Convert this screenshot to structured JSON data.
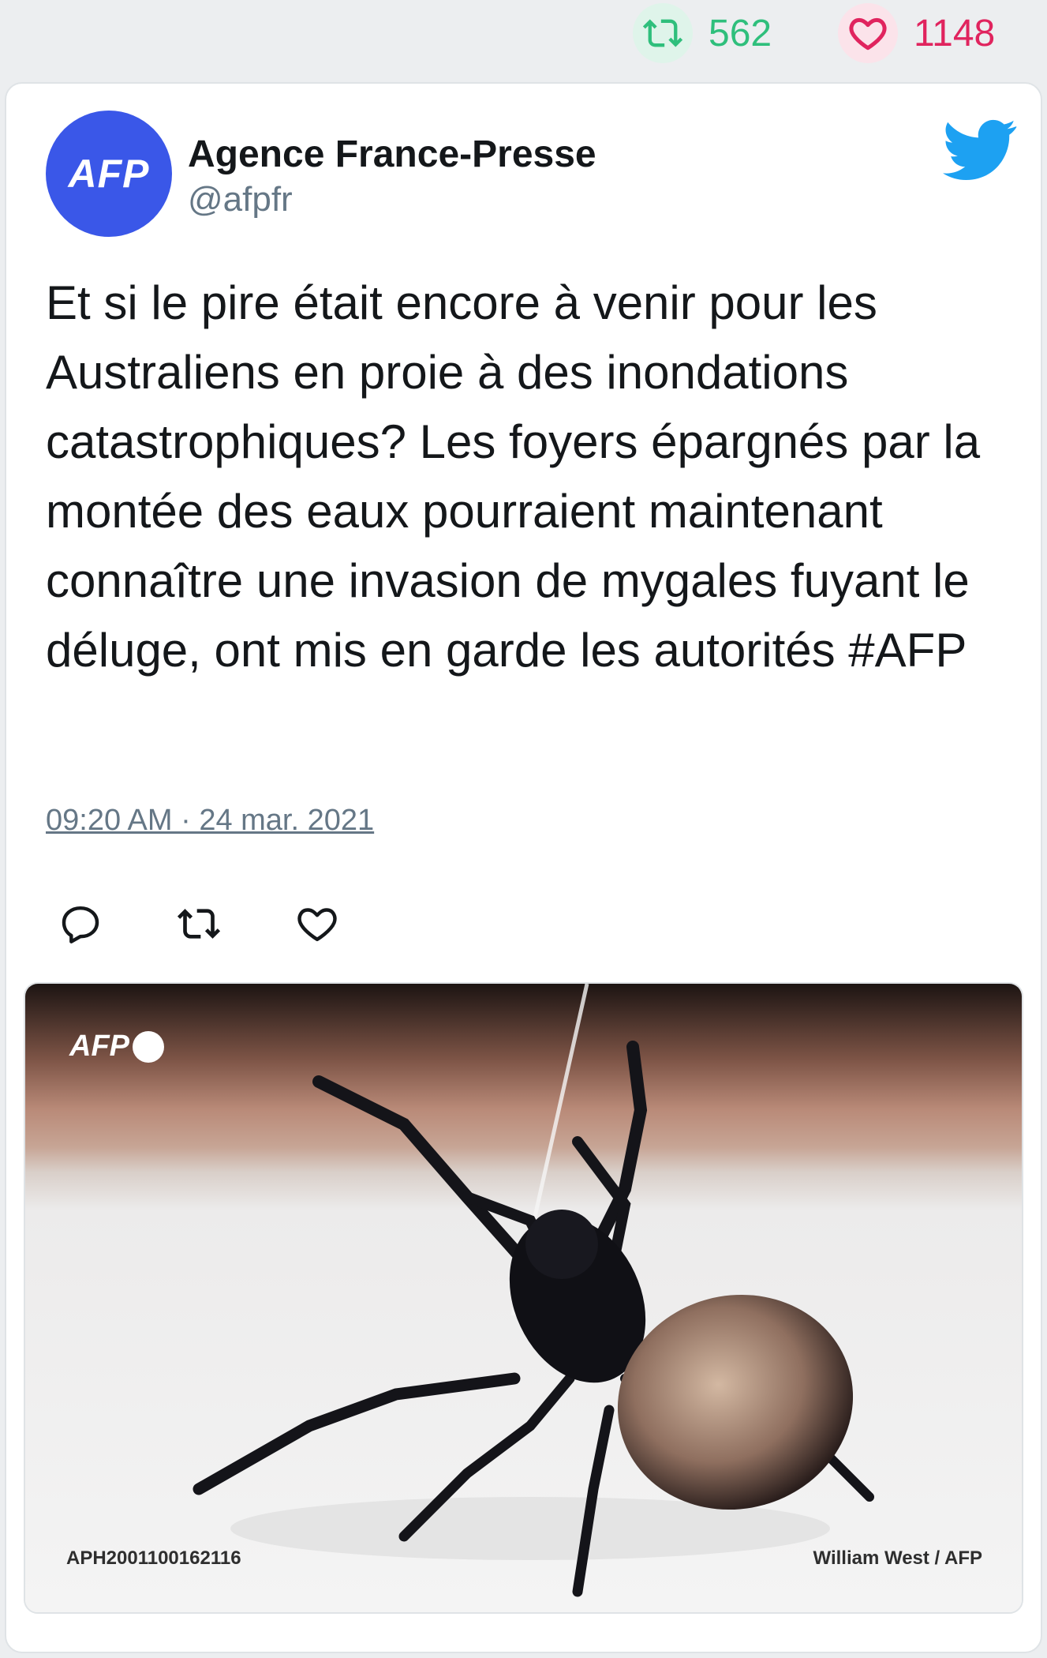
{
  "stats": {
    "retweets": "562",
    "likes": "1148"
  },
  "tweet": {
    "avatar_text": "AFP",
    "author_name": "Agence France-Presse",
    "author_handle": "@afpfr",
    "text": "Et si le pire était encore à venir pour les Australiens en proie à des inondations catastrophiques? Les foyers épargnés par la montée des eaux pourraient maintenant connaître une invasion de mygales fuyant le déluge, ont mis en garde les autorités #AFP",
    "timestamp": "09:20 AM · 24 mar. 2021"
  },
  "media": {
    "watermark": "AFP",
    "photo_id": "APH2001100162116",
    "credit": "William West / AFP"
  },
  "colors": {
    "twitter_blue": "#1da1f2",
    "retweet_green": "#2fbf7c",
    "like_pink": "#e0245e",
    "afp_blue": "#3a57e8"
  },
  "icons": [
    "retweet-icon",
    "heart-icon",
    "twitter-bird-icon",
    "reply-icon"
  ]
}
